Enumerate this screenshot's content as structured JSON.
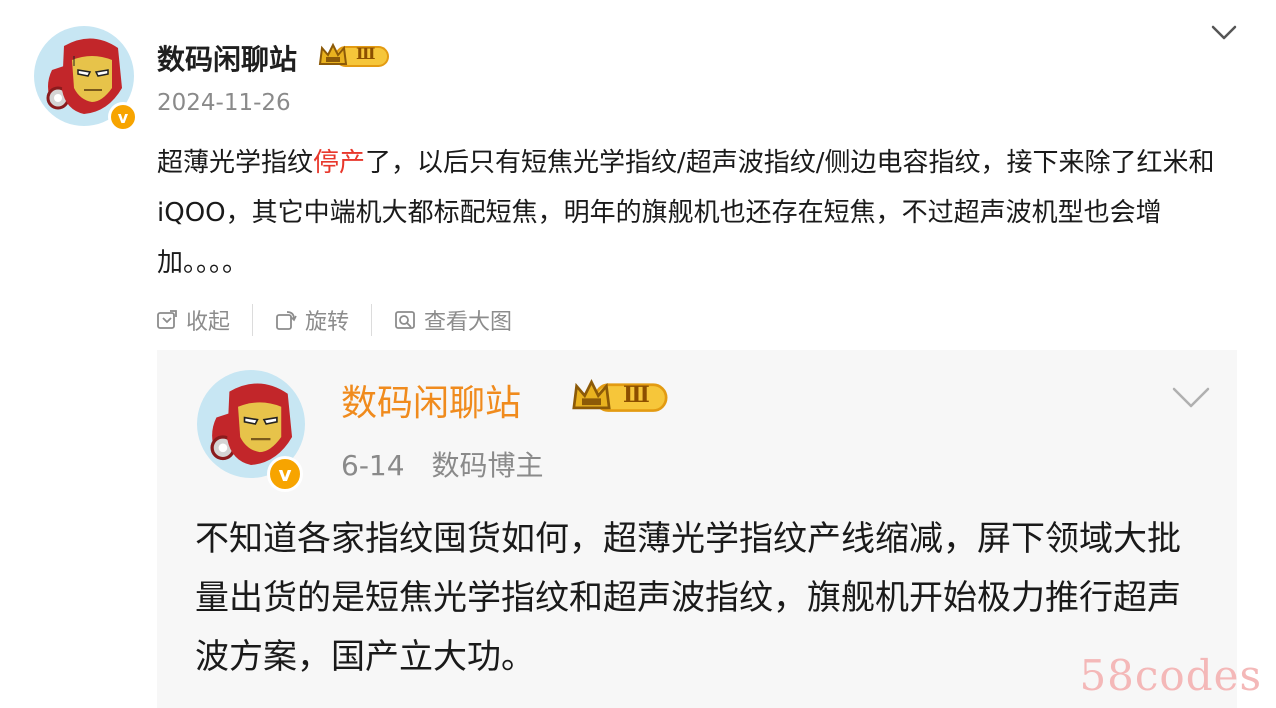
{
  "post": {
    "author": "数码闲聊站",
    "level_badge": "Ⅲ",
    "verified_mark": "v",
    "date": "2024-11-26",
    "text_before": "超薄光学指纹",
    "text_highlight": "停产",
    "text_after": "了，以后只有短焦光学指纹/超声波指纹/侧边电容指纹，接下来除了红米和iQOO，其它中端机大都标配短焦，明年的旗舰机也还存在短焦，不过超声波机型也会增加。。。。",
    "actions": [
      {
        "label": "收起",
        "icon": "collapse-icon"
      },
      {
        "label": "旋转",
        "icon": "rotate-icon"
      },
      {
        "label": "查看大图",
        "icon": "view-large-icon"
      }
    ]
  },
  "quoted": {
    "author": "数码闲聊站",
    "level_badge": "Ⅲ",
    "verified_mark": "v",
    "date": "6-14",
    "role": "数码博主",
    "text": "不知道各家指纹囤货如何，超薄光学指纹产线缩减，屏下领域大批量出货的是短焦光学指纹和超声波指纹，旗舰机开始极力推行超声波方案，国产立大功。"
  },
  "watermark": "58codes",
  "colors": {
    "highlight": "#e8372b",
    "quoted_name": "#f08b1d",
    "verified": "#f7a400",
    "watermark": "#f4b8b8"
  }
}
